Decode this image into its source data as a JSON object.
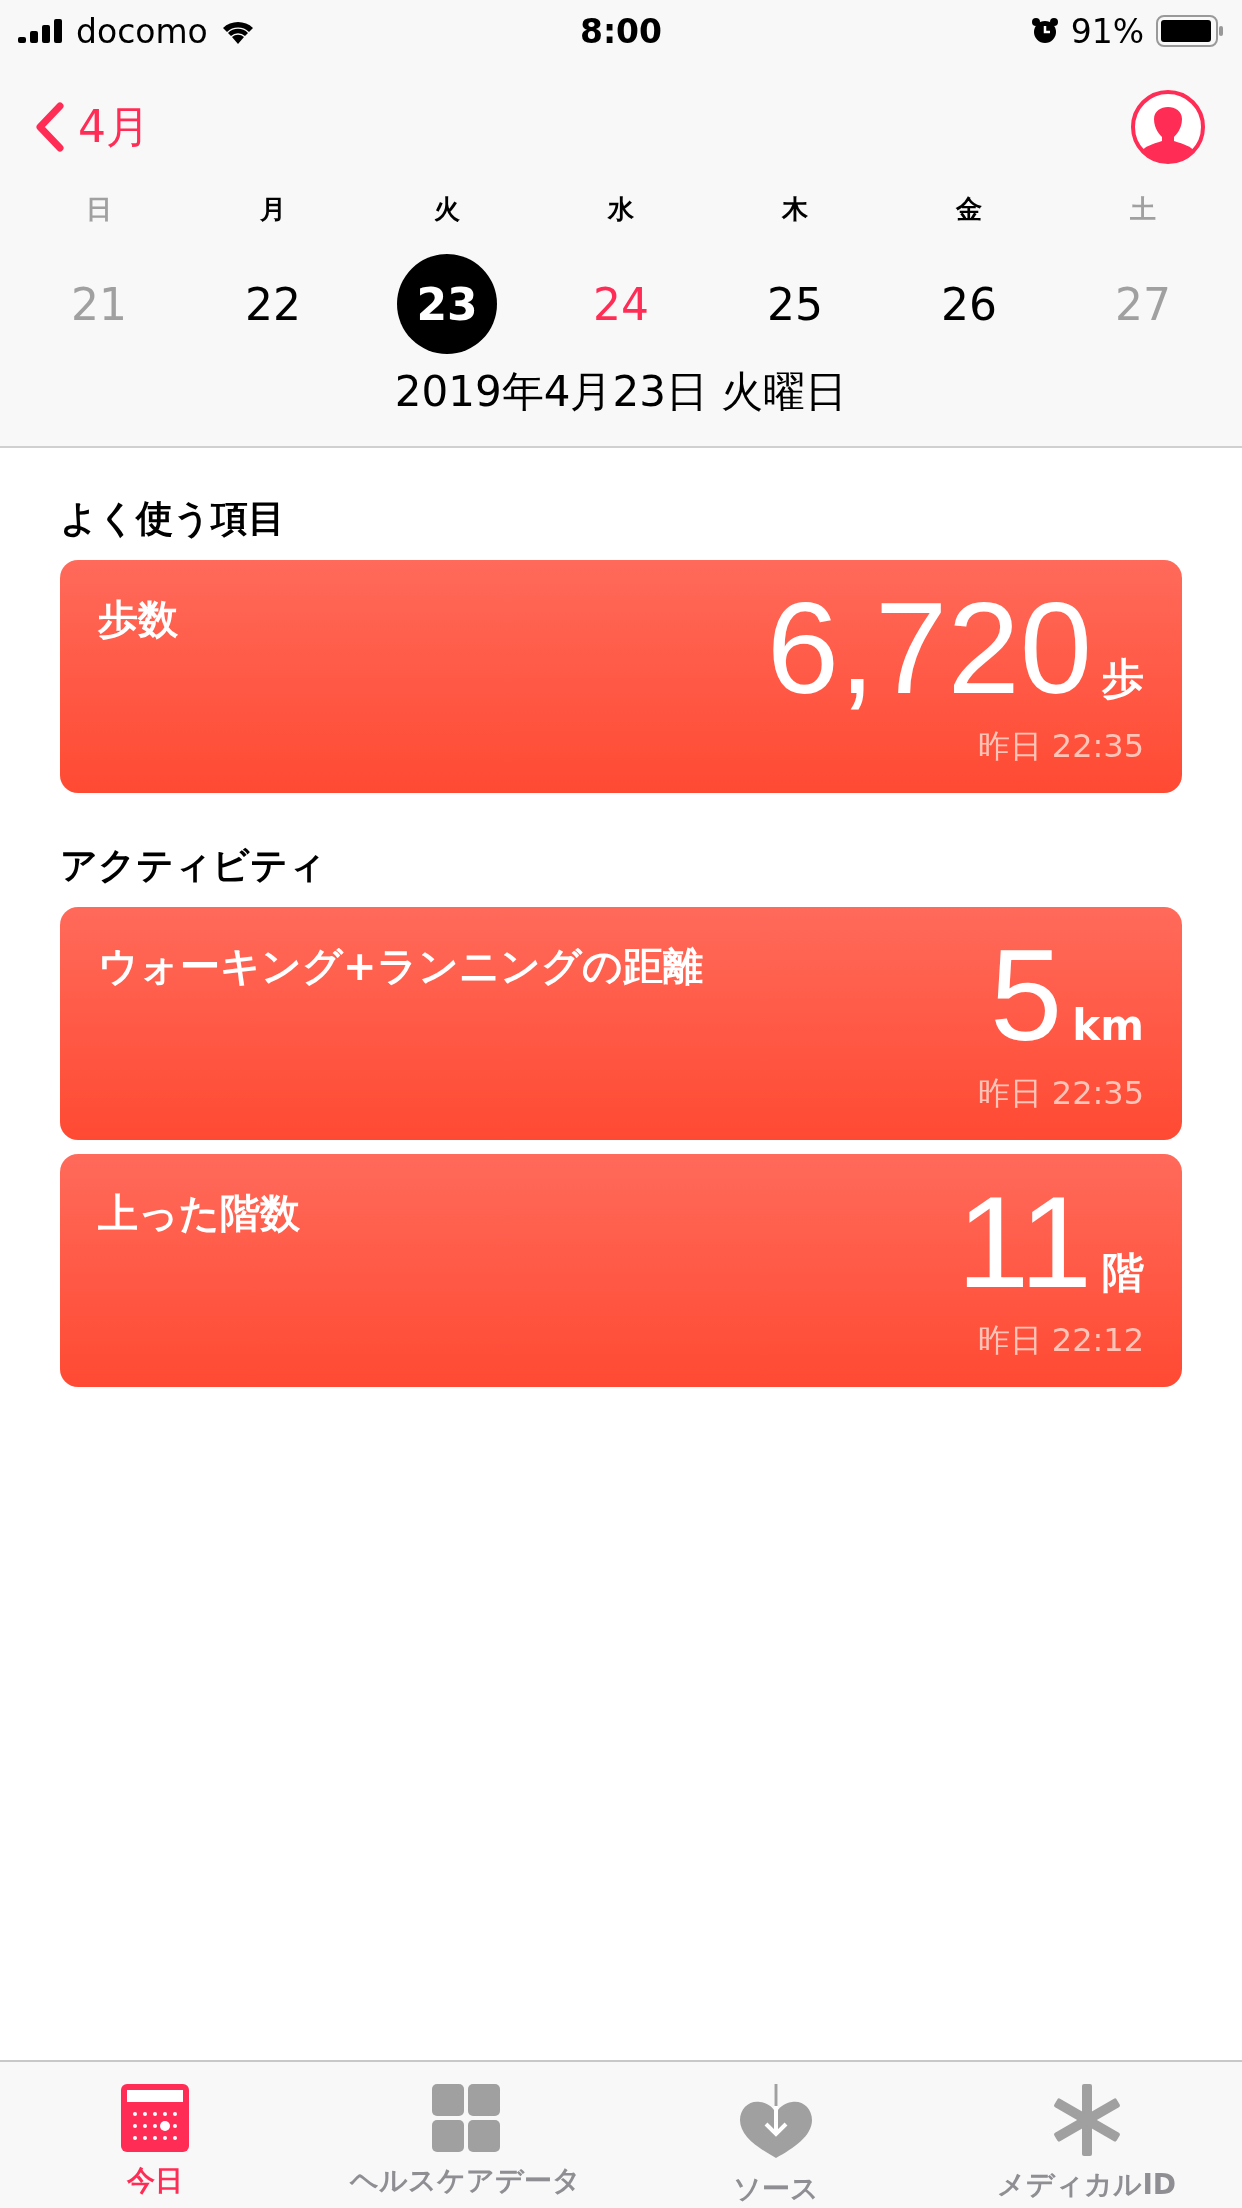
{
  "status_bar": {
    "carrier": "docomo",
    "time": "8:00",
    "battery": "91%"
  },
  "nav": {
    "back_label": "4月"
  },
  "week": [
    {
      "weekday": "日",
      "day": "21",
      "weekend": true,
      "today": false,
      "selected": false
    },
    {
      "weekday": "月",
      "day": "22",
      "weekend": false,
      "today": false,
      "selected": false
    },
    {
      "weekday": "火",
      "day": "23",
      "weekend": false,
      "today": false,
      "selected": true
    },
    {
      "weekday": "水",
      "day": "24",
      "weekend": false,
      "today": true,
      "selected": false
    },
    {
      "weekday": "木",
      "day": "25",
      "weekend": false,
      "today": false,
      "selected": false
    },
    {
      "weekday": "金",
      "day": "26",
      "weekend": false,
      "today": false,
      "selected": false
    },
    {
      "weekday": "土",
      "day": "27",
      "weekend": true,
      "today": false,
      "selected": false
    }
  ],
  "selected_date": "2019年4月23日 火曜日",
  "sections": [
    {
      "title": "よく使う項目",
      "cards": [
        {
          "title": "歩数",
          "value": "6,720",
          "unit": "歩",
          "time": "昨日 22:35"
        }
      ]
    },
    {
      "title": "アクティビティ",
      "cards": [
        {
          "title": "ウォーキング+ランニングの距離",
          "value": "5",
          "unit": "km",
          "time": "昨日 22:35"
        },
        {
          "title": "上った階数",
          "value": "11",
          "unit": "階",
          "time": "昨日 22:12"
        }
      ]
    }
  ],
  "tab_bar": [
    {
      "kind": "today",
      "label": "今日",
      "selected": true
    },
    {
      "kind": "data",
      "label": "ヘルスケアデータ",
      "selected": false
    },
    {
      "kind": "sources",
      "label": "ソース",
      "selected": false
    },
    {
      "kind": "medical",
      "label": "メディカルID",
      "selected": false
    }
  ]
}
